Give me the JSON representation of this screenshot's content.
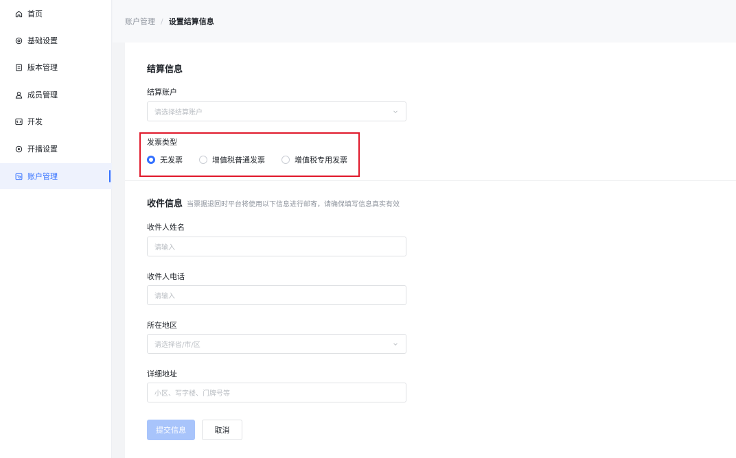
{
  "sidebar": {
    "items": [
      {
        "label": "首页",
        "icon": "home-icon"
      },
      {
        "label": "基础设置",
        "icon": "settings-icon"
      },
      {
        "label": "版本管理",
        "icon": "document-icon"
      },
      {
        "label": "成员管理",
        "icon": "user-icon"
      },
      {
        "label": "开发",
        "icon": "code-icon"
      },
      {
        "label": "开播设置",
        "icon": "broadcast-icon"
      },
      {
        "label": "账户管理",
        "icon": "account-icon",
        "active": true
      }
    ]
  },
  "breadcrumb": {
    "parent": "账户管理",
    "separator": "/",
    "current": "设置结算信息"
  },
  "settlement": {
    "title": "结算信息",
    "account_label": "结算账户",
    "account_placeholder": "请选择结算账户"
  },
  "invoice": {
    "label": "发票类型",
    "options": [
      "无发票",
      "增值税普通发票",
      "增值税专用发票"
    ],
    "selected": "无发票"
  },
  "shipping": {
    "title": "收件信息",
    "description": "当票据退回时平台将使用以下信息进行邮寄，请确保填写信息真实有效",
    "name_label": "收件人姓名",
    "name_placeholder": "请输入",
    "phone_label": "收件人电话",
    "phone_placeholder": "请输入",
    "region_label": "所在地区",
    "region_placeholder": "请选择省/市/区",
    "address_label": "详细地址",
    "address_placeholder": "小区、写字楼、门牌号等"
  },
  "actions": {
    "submit_label": "提交信息",
    "cancel_label": "取消"
  },
  "colors": {
    "accent": "#3370ff",
    "highlight_border": "#e0182a",
    "submit_disabled": "#a8c4fb"
  }
}
